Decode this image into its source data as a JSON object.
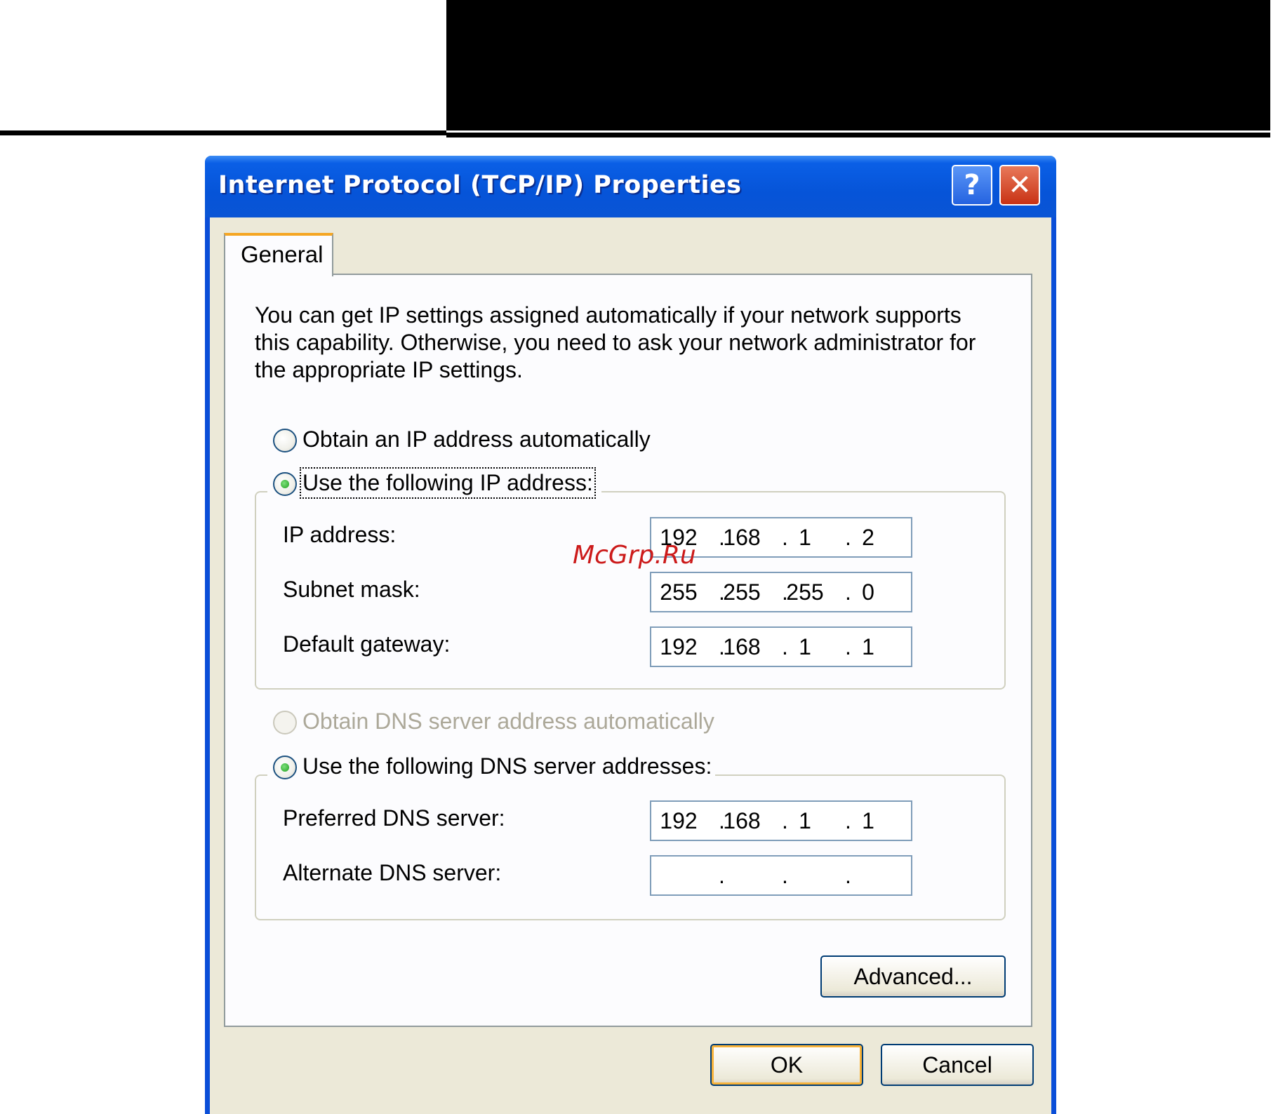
{
  "window": {
    "title": "Internet Protocol (TCP/IP) Properties",
    "help_label": "?",
    "close_label": "✕"
  },
  "tab": {
    "label": "General"
  },
  "intro": "You can get IP settings assigned automatically if your network supports this capability. Otherwise, you need to ask your network administrator for the appropriate IP settings.",
  "ip_mode": {
    "auto_label": "Obtain an IP address automatically",
    "manual_label": "Use the following IP address:",
    "selected": "manual"
  },
  "ip_fields": {
    "ip_address": {
      "label": "IP address:",
      "octets": [
        "192",
        "168",
        "1",
        "2"
      ]
    },
    "subnet_mask": {
      "label": "Subnet mask:",
      "octets": [
        "255",
        "255",
        "255",
        "0"
      ]
    },
    "default_gateway": {
      "label": "Default gateway:",
      "octets": [
        "192",
        "168",
        "1",
        "1"
      ]
    }
  },
  "dns_mode": {
    "auto_label": "Obtain DNS server address automatically",
    "manual_label": "Use the following DNS server addresses:",
    "selected": "manual",
    "auto_disabled": true
  },
  "dns_fields": {
    "preferred": {
      "label": "Preferred DNS server:",
      "octets": [
        "192",
        "168",
        "1",
        "1"
      ]
    },
    "alternate": {
      "label": "Alternate DNS server:",
      "octets": [
        "",
        "",
        "",
        ""
      ]
    }
  },
  "buttons": {
    "advanced": "Advanced...",
    "ok": "OK",
    "cancel": "Cancel"
  },
  "watermark": "McGrp.Ru",
  "colors": {
    "titlebar": "#0654d8",
    "dialog_bg": "#ece9d8",
    "tab_accent": "#f5a623",
    "watermark": "#cc1a1a"
  }
}
